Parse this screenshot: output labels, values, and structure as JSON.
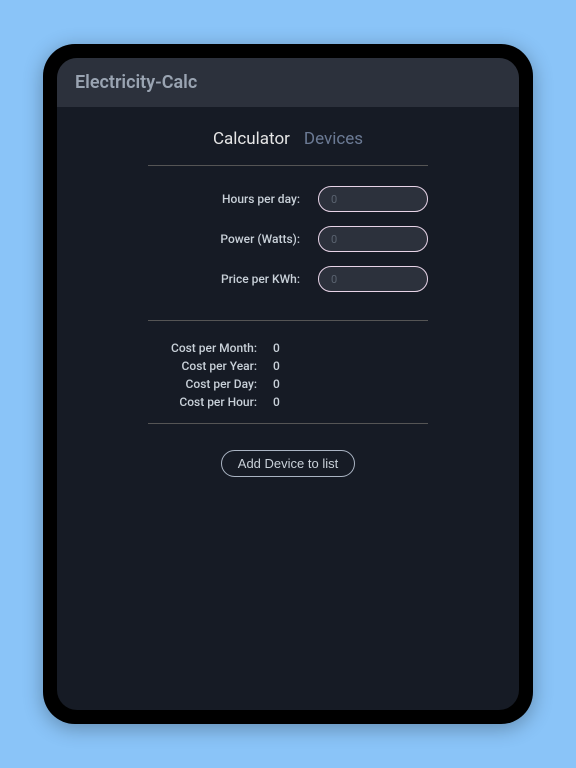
{
  "app": {
    "title": "Electricity-Calc"
  },
  "tabs": {
    "calculator": "Calculator",
    "devices": "Devices",
    "active": "calculator"
  },
  "inputs": {
    "hours_label": "Hours per day:",
    "hours_placeholder": "0",
    "power_label": "Power (Watts):",
    "power_placeholder": "0",
    "price_label": "Price per KWh:",
    "price_placeholder": "0"
  },
  "results": {
    "month_label": "Cost per Month:",
    "month_value": "0",
    "year_label": "Cost per Year:",
    "year_value": "0",
    "day_label": "Cost per Day:",
    "day_value": "0",
    "hour_label": "Cost per Hour:",
    "hour_value": "0"
  },
  "actions": {
    "add_device_label": "Add Device to list"
  }
}
